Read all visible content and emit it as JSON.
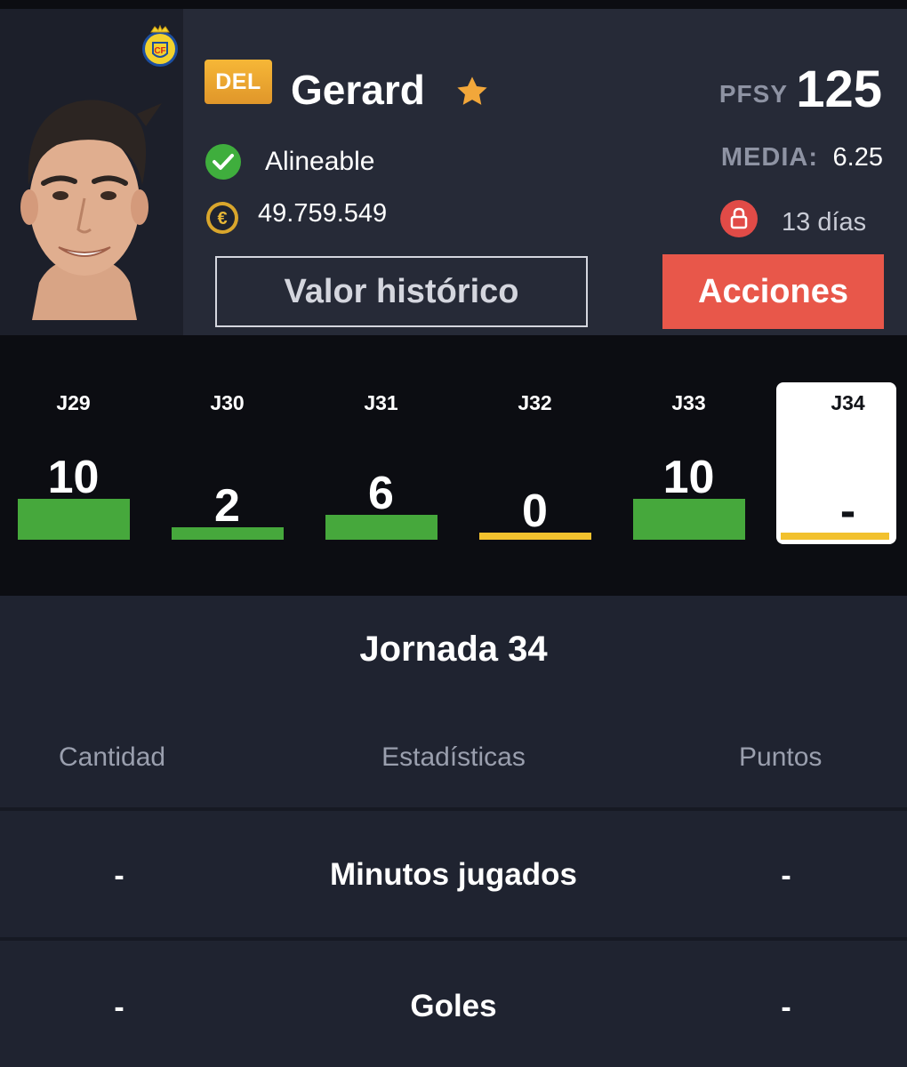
{
  "colors": {
    "background": "#1f2330",
    "header": "#262a37",
    "rounds_bg": "#0c0d12",
    "accent_red": "#e8574a",
    "position_badge": "#f0a833",
    "bar_green": "#46a83c",
    "bar_yellow": "#f2c12e",
    "muted_text": "#8e93a3"
  },
  "player": {
    "position": "DEL",
    "name": "Gerard",
    "favorite_icon": "star-icon",
    "club_icon": "villarreal-crest-icon",
    "status": "Alineable",
    "status_icon": "check-circle-icon",
    "market_value": "49.759.549",
    "market_value_icon": "euro-coin-icon"
  },
  "stats": {
    "pfsy_label": "PFSY",
    "pfsy_value": "125",
    "media_label": "MEDIA:",
    "media_value": "6.25",
    "lock_icon": "lock-icon",
    "lock_days": "13 días"
  },
  "buttons": {
    "history": "Valor histórico",
    "actions": "Acciones"
  },
  "rounds": [
    {
      "label": "J29",
      "points": "10",
      "value": 10,
      "color": "green"
    },
    {
      "label": "J30",
      "points": "2",
      "value": 2,
      "color": "green"
    },
    {
      "label": "J31",
      "points": "6",
      "value": 6,
      "color": "green"
    },
    {
      "label": "J32",
      "points": "0",
      "value": 0,
      "color": "yellow"
    },
    {
      "label": "J33",
      "points": "10",
      "value": 10,
      "color": "green"
    },
    {
      "label": "J34",
      "points": "-",
      "value": null,
      "color": "yellow",
      "active": true
    }
  ],
  "jornada": {
    "title": "Jornada 34",
    "columns": {
      "quantity": "Cantidad",
      "stats": "Estadísticas",
      "points": "Puntos"
    },
    "rows": [
      {
        "quantity": "-",
        "name": "Minutos jugados",
        "points": "-"
      },
      {
        "quantity": "-",
        "name": "Goles",
        "points": "-"
      }
    ]
  }
}
